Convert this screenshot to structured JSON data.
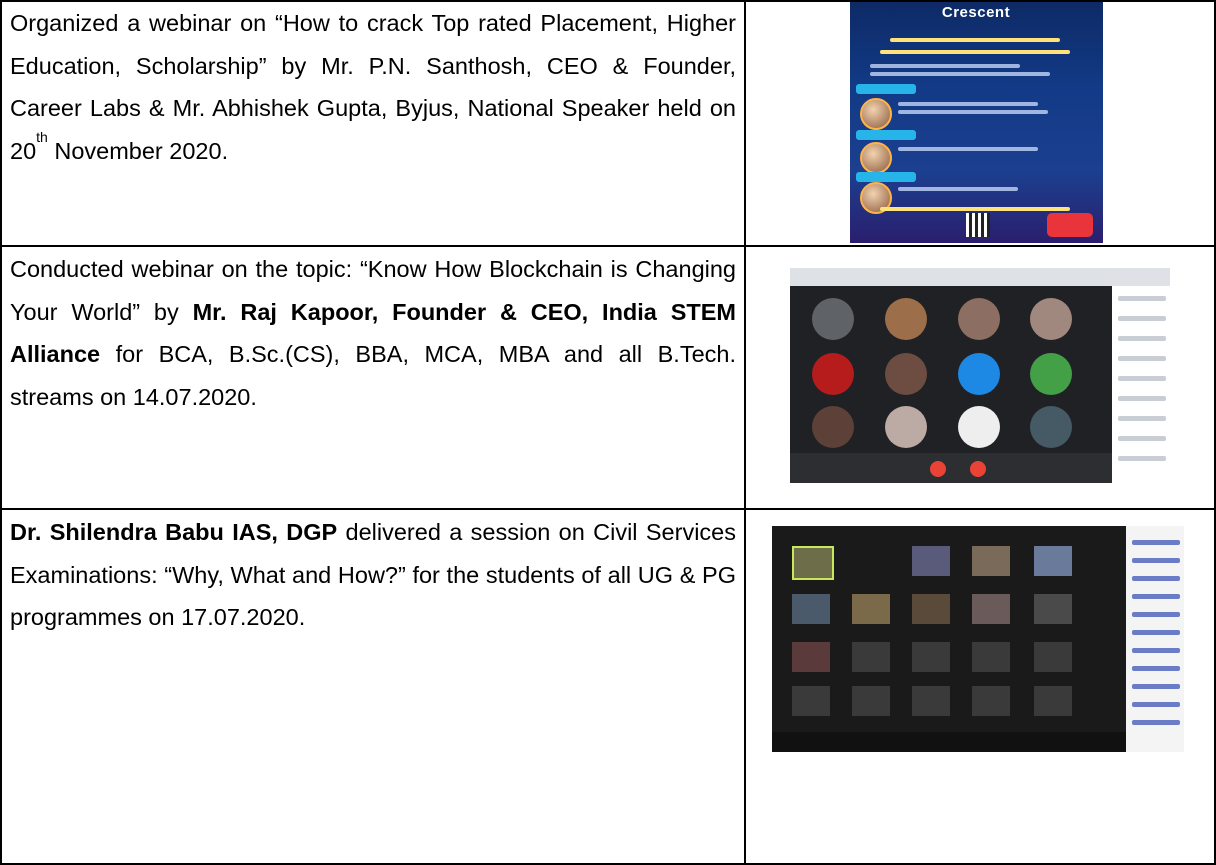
{
  "rows": [
    {
      "text_html": "Organized a webinar on “How to crack Top rated Placement, Higher Education, Scholarship” by Mr. P.N. Santhosh, CEO &amp; Founder, Career Labs &amp; Mr. Abhishek Gupta, Byjus, National Speaker held on 20<sup>th</sup> November 2020.",
      "image_label": "webinar-poster",
      "poster_logo": "Crescent"
    },
    {
      "text_html": "Conducted webinar on the topic: “Know How Blockchain is Changing Your World” by <b>Mr. Raj Kapoor, Founder &amp; CEO, India STEM Alliance</b> for BCA, B.Sc.(CS), BBA, MCA, MBA and all B.Tech. streams on 14.07.2020.",
      "image_label": "google-meet-screenshot"
    },
    {
      "text_html": "<b>Dr. Shilendra Babu IAS, DGP</b> delivered a session on Civil Services Examinations: “Why, What and How?” for the students of all UG &amp; PG programmes on 17.07.2020.",
      "image_label": "zoom-meeting-screenshot"
    }
  ],
  "colors": {
    "border": "#000000",
    "poster_bg": "#123a86",
    "meet_bg": "#202124"
  }
}
